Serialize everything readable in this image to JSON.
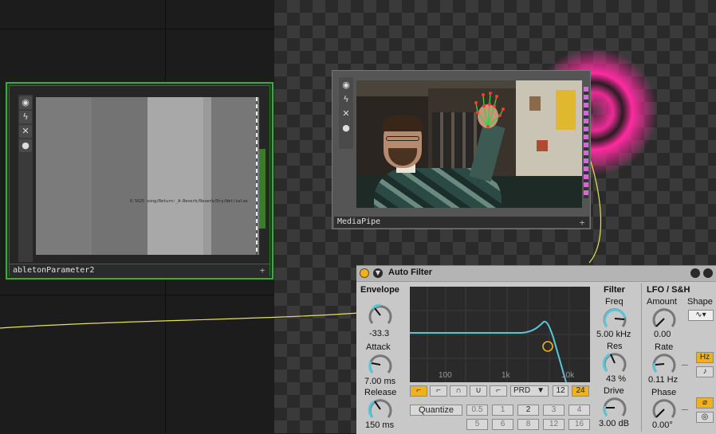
{
  "nodes": {
    "parameter_node": {
      "label": "abletonParameter2",
      "readout": "0.5625  song/Return:_A-Reverb/Reverb/Dry/Wet/value"
    },
    "mediapipe_node": {
      "label": "MediaPipe"
    }
  },
  "auto_filter": {
    "title": "Auto Filter",
    "envelope": {
      "section": "Envelope",
      "amount_value": "-33.3",
      "attack_label": "Attack",
      "attack_value": "7.00 ms",
      "release_label": "Release",
      "release_value": "150 ms"
    },
    "graph": {
      "freq_labels": [
        "100",
        "1k",
        "10k"
      ]
    },
    "filter": {
      "section": "Filter",
      "freq_label": "Freq",
      "freq_value": "5.00 kHz",
      "res_label": "Res",
      "res_value": "43 %",
      "drive_label": "Drive",
      "drive_value": "3.00 dB"
    },
    "lfo": {
      "section": "LFO / S&H",
      "amount_label": "Amount",
      "amount_value": "0.00",
      "shape_label": "Shape",
      "rate_label": "Rate",
      "rate_value": "0.11 Hz",
      "phase_label": "Phase",
      "phase_value": "0.00°",
      "hz_label": "Hz"
    },
    "circuit": {
      "type_value": "PRD",
      "slope_12": "12",
      "slope_24": "24"
    },
    "quantize": {
      "label": "Quantize",
      "values_row1": [
        "0.5",
        "1",
        "2",
        "3",
        "4"
      ],
      "values_row2": [
        "5",
        "6",
        "8",
        "12",
        "16"
      ]
    }
  },
  "colors": {
    "accent": "#f0b020",
    "node_green": "#2db52d",
    "wire": "#e8e05a",
    "glow": "#ff2aa0",
    "knob": "#58c6d8"
  }
}
